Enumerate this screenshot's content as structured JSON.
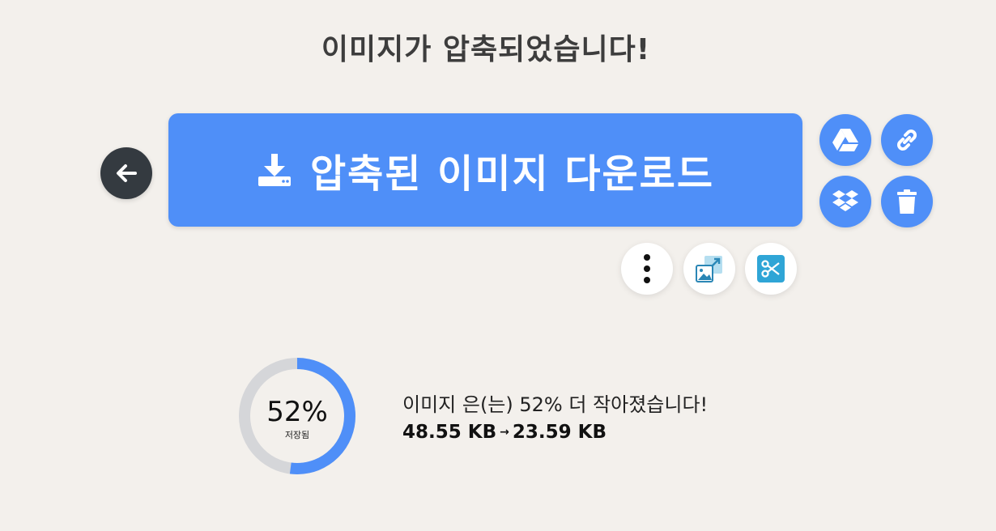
{
  "title": "이미지가 압축되었습니다!",
  "download": {
    "label": "압축된 이미지 다운로드"
  },
  "icons": {
    "back": "arrow-left-icon",
    "download": "download-icon",
    "google_drive": "google-drive-icon",
    "link": "link-icon",
    "dropbox": "dropbox-icon",
    "delete": "trash-icon",
    "more": "more-vertical-icon",
    "resize": "image-resize-icon",
    "crop": "scissors-icon"
  },
  "result": {
    "percent_label": "52%",
    "saved_label": "저장됨",
    "saved_fraction": 0.52,
    "message": "이미지 은(는) 52% 더 작아졌습니다!",
    "original_size": "48.55 KB",
    "arrow": "→",
    "compressed_size": "23.59 KB"
  },
  "colors": {
    "primary": "#4f8ff8",
    "dark": "#343a40",
    "background": "#f3f0ec",
    "ring_track": "#d5d6d9"
  }
}
